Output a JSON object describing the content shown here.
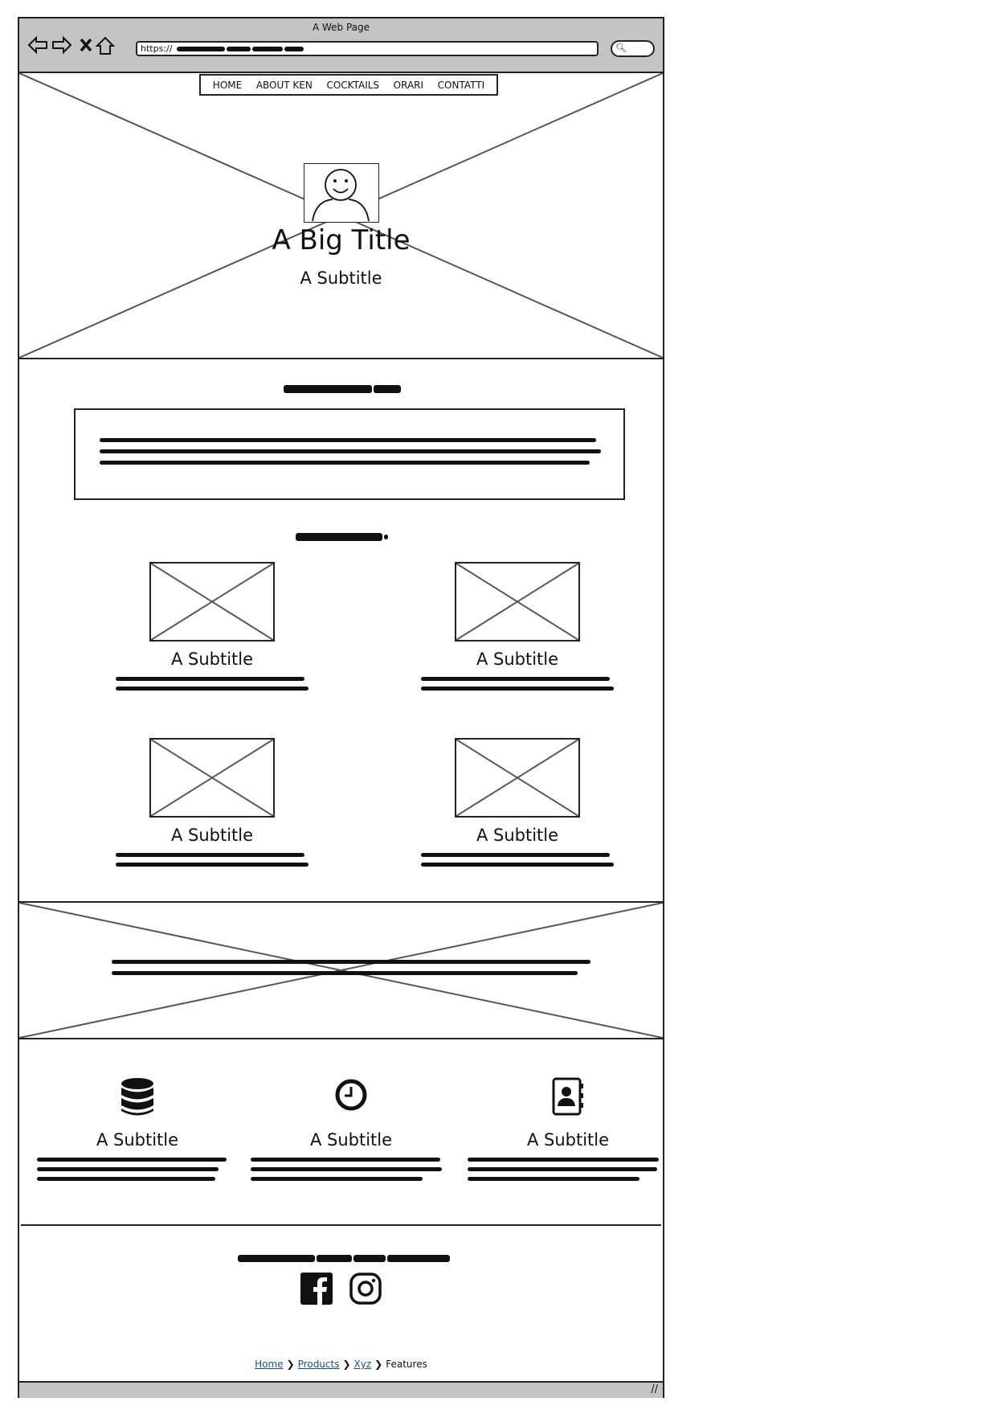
{
  "window": {
    "title": "A Web Page"
  },
  "toolbar": {
    "url_prefix": "https://",
    "back_icon": "arrow-left-icon",
    "forward_icon": "arrow-right-icon",
    "stop_icon": "close-icon",
    "home_icon": "home-icon",
    "search_icon": "search-icon"
  },
  "nav": {
    "items": [
      "HOME",
      "ABOUT KEN",
      "COCKTAILS",
      "ORARI",
      "CONTATTI"
    ]
  },
  "hero": {
    "title": "A Big Title",
    "subtitle": "A Subtitle"
  },
  "cards": [
    {
      "subtitle": "A Subtitle"
    },
    {
      "subtitle": "A Subtitle"
    },
    {
      "subtitle": "A Subtitle"
    },
    {
      "subtitle": "A Subtitle"
    }
  ],
  "features": [
    {
      "icon": "database-icon",
      "subtitle": "A Subtitle"
    },
    {
      "icon": "clock-icon",
      "subtitle": "A Subtitle"
    },
    {
      "icon": "contact-book-icon",
      "subtitle": "A Subtitle"
    }
  ],
  "footer": {
    "social": [
      "facebook-icon",
      "instagram-icon"
    ],
    "breadcrumb": [
      "Home",
      "Products",
      "Xyz",
      "Features"
    ]
  }
}
